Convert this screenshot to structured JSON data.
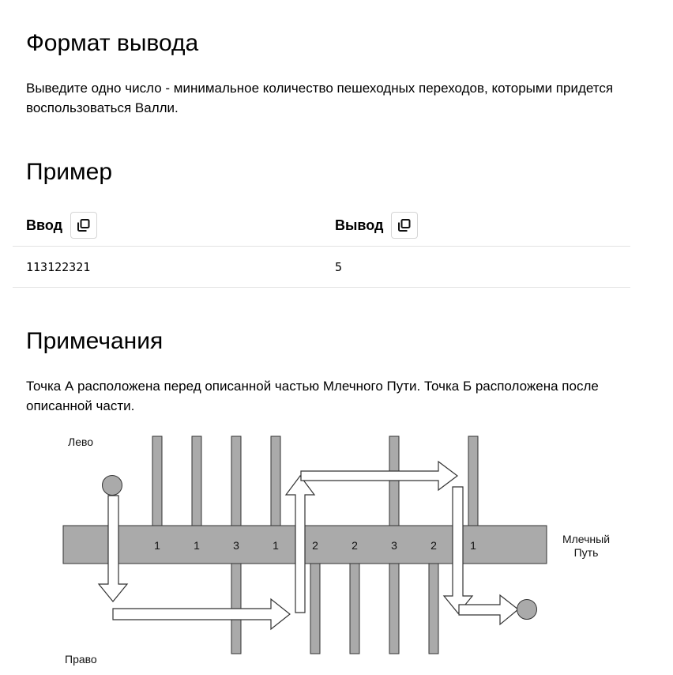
{
  "output_format": {
    "title": "Формат вывода",
    "text": "Выведите одно число - минимальное количество пешеходных переходов, которыми придется воспользоваться Валли."
  },
  "example": {
    "title": "Пример",
    "input_label": "Ввод",
    "output_label": "Вывод",
    "input_value": "113122321",
    "output_value": "5"
  },
  "notes": {
    "title": "Примечания",
    "text": "Точка А расположена перед описанной частью Млечного Пути. Точка Б расположена после описанной части."
  },
  "diagram": {
    "label_left": "Лево",
    "label_right": "Право",
    "label_road_line1": "Млечный",
    "label_road_line2": "Путь",
    "crossing_digits": [
      "1",
      "1",
      "3",
      "1",
      "2",
      "2",
      "3",
      "2",
      "1"
    ],
    "colors": {
      "road_fill": "#aaaaaa",
      "stroke": "#333333"
    }
  },
  "icons": {
    "copy": "copy-icon"
  }
}
